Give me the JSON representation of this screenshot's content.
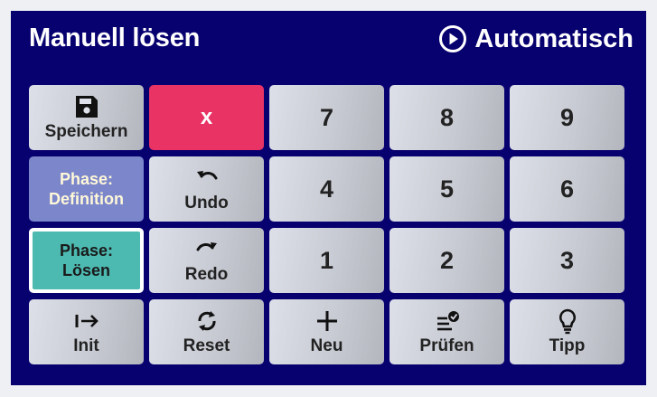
{
  "header": {
    "title": "Manuell lösen",
    "auto_label": "Automatisch"
  },
  "keypad": {
    "save": "Speichern",
    "clear": "x",
    "undo": "Undo",
    "redo": "Redo",
    "phase_definition": [
      "Phase:",
      "Definition"
    ],
    "phase_solve": [
      "Phase:",
      "Lösen"
    ],
    "digits": [
      "7",
      "8",
      "9",
      "4",
      "5",
      "6",
      "1",
      "2",
      "3"
    ],
    "init": "Init",
    "reset": "Reset",
    "new": "Neu",
    "check": "Prüfen",
    "hint": "Tipp"
  },
  "colors": {
    "panel": "#07006f",
    "clear_button": "#e83364",
    "phase_definition": "#7b86cb",
    "phase_solve_active": "#4dbab2"
  },
  "icons": {
    "save": "floppy-disk-icon",
    "undo": "undo-arrow-icon",
    "redo": "redo-arrow-icon",
    "init": "arrow-to-right-icon",
    "reset": "refresh-icon",
    "new": "plus-icon",
    "check": "list-check-icon",
    "hint": "lightbulb-icon",
    "auto": "play-circle-icon"
  },
  "state": {
    "active_phase": "Lösen"
  }
}
